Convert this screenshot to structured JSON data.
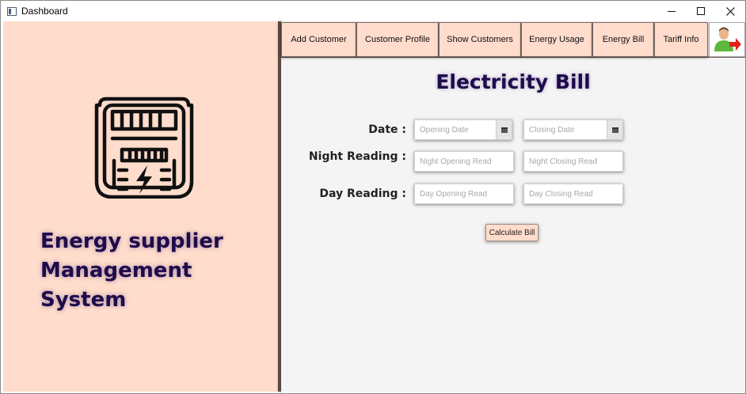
{
  "window": {
    "title": "Dashboard"
  },
  "brand": {
    "line1": "Energy supplier",
    "line2": "Management",
    "line3": "System"
  },
  "nav": {
    "items": [
      {
        "label": "Add Customer"
      },
      {
        "label": "Customer Profile"
      },
      {
        "label": "Show Customers"
      },
      {
        "label": "Energy Usage"
      },
      {
        "label": "Energy Bill"
      },
      {
        "label": "Tariff Info"
      }
    ],
    "logout_icon": "logout-user-icon"
  },
  "page": {
    "title": "Electricity Bill"
  },
  "form": {
    "date_label": "Date :",
    "night_label": "Night Reading :",
    "day_label": "Day Reading :",
    "opening_date_placeholder": "Opening Date",
    "closing_date_placeholder": "Closing Date",
    "night_opening_placeholder": "Night Opening Read",
    "night_closing_placeholder": "Night Closing Read",
    "day_opening_placeholder": "Day Opening Read",
    "day_closing_placeholder": "Day Closing Read",
    "calculate_label": "Calculate Bill"
  },
  "colors": {
    "panel": "#ffdccb",
    "title": "#1e0b4b",
    "content_bg": "#f4f4f4"
  }
}
